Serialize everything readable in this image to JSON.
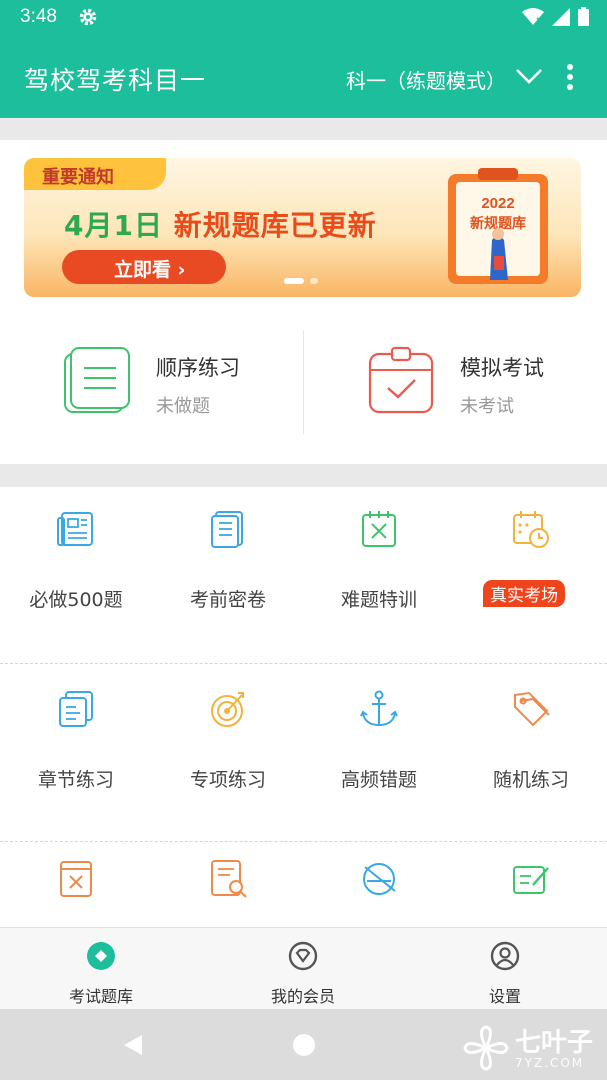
{
  "status": {
    "time": "3:48"
  },
  "app_bar": {
    "title": "驾校驾考科目一",
    "mode": "科一（练题模式）"
  },
  "banner": {
    "tag": "重要通知",
    "headline_num": "4月1日",
    "headline_text": "新规题库已更新",
    "cta": "立即看 ›",
    "board_year": "2022",
    "board_text": "新规题库"
  },
  "quick": {
    "sequence": {
      "label": "顺序练习",
      "sub": "未做题"
    },
    "mock": {
      "label": "模拟考试",
      "sub": "未考试"
    }
  },
  "grid": [
    {
      "label": "必做500题",
      "icon": "newspaper-icon"
    },
    {
      "label": "考前密卷",
      "icon": "booklet-icon"
    },
    {
      "label": "难题特训",
      "icon": "x-note-icon"
    },
    {
      "label": "",
      "icon": "calendar-clock-icon",
      "badge": "真实考场"
    },
    {
      "label": "章节练习",
      "icon": "documents-icon"
    },
    {
      "label": "专项练习",
      "icon": "target-icon"
    },
    {
      "label": "高频错题",
      "icon": "anchor-icon"
    },
    {
      "label": "随机练习",
      "icon": "tags-icon"
    }
  ],
  "bottom_nav": [
    {
      "label": "考试题库",
      "icon": "question-bank-icon",
      "active": true
    },
    {
      "label": "我的会员",
      "icon": "member-icon",
      "active": false
    },
    {
      "label": "设置",
      "icon": "settings-user-icon",
      "active": false
    }
  ],
  "watermark": {
    "text": "七叶子",
    "sub": "7YZ.COM"
  },
  "colors": {
    "primary": "#1dbe9b",
    "accent": "#f0441c",
    "blue_icon": "#3aa7e6",
    "green_icon": "#3cc46a",
    "orange_icon": "#f39a3b"
  }
}
